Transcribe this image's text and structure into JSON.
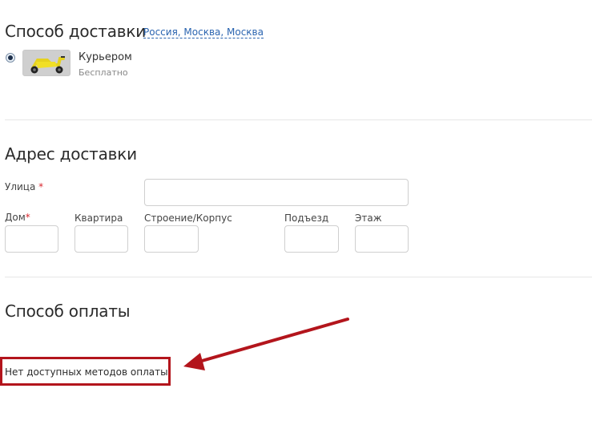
{
  "delivery": {
    "title": "Способ доставки",
    "location_link": "Россия, Москва, Москва",
    "method": {
      "title": "Курьером",
      "subtitle": "Бесплатно",
      "icon": "courier-scooter-icon",
      "selected": true
    }
  },
  "address": {
    "title": "Адрес доставки",
    "required_mark": "*",
    "fields": {
      "street": {
        "label": "Улица",
        "required": true,
        "value": ""
      },
      "house": {
        "label": "Дом",
        "required": true,
        "value": ""
      },
      "apartment": {
        "label": "Квартира",
        "value": ""
      },
      "building": {
        "label": "Строение/Корпус",
        "value": ""
      },
      "entrance": {
        "label": "Подъезд",
        "value": ""
      },
      "floor": {
        "label": "Этаж",
        "value": ""
      }
    }
  },
  "payment": {
    "title": "Способ оплаты",
    "empty_message": "Нет доступных методов оплаты"
  },
  "colors": {
    "link": "#2a64b0",
    "required": "#d9282f",
    "annotation": "#b3151c"
  }
}
